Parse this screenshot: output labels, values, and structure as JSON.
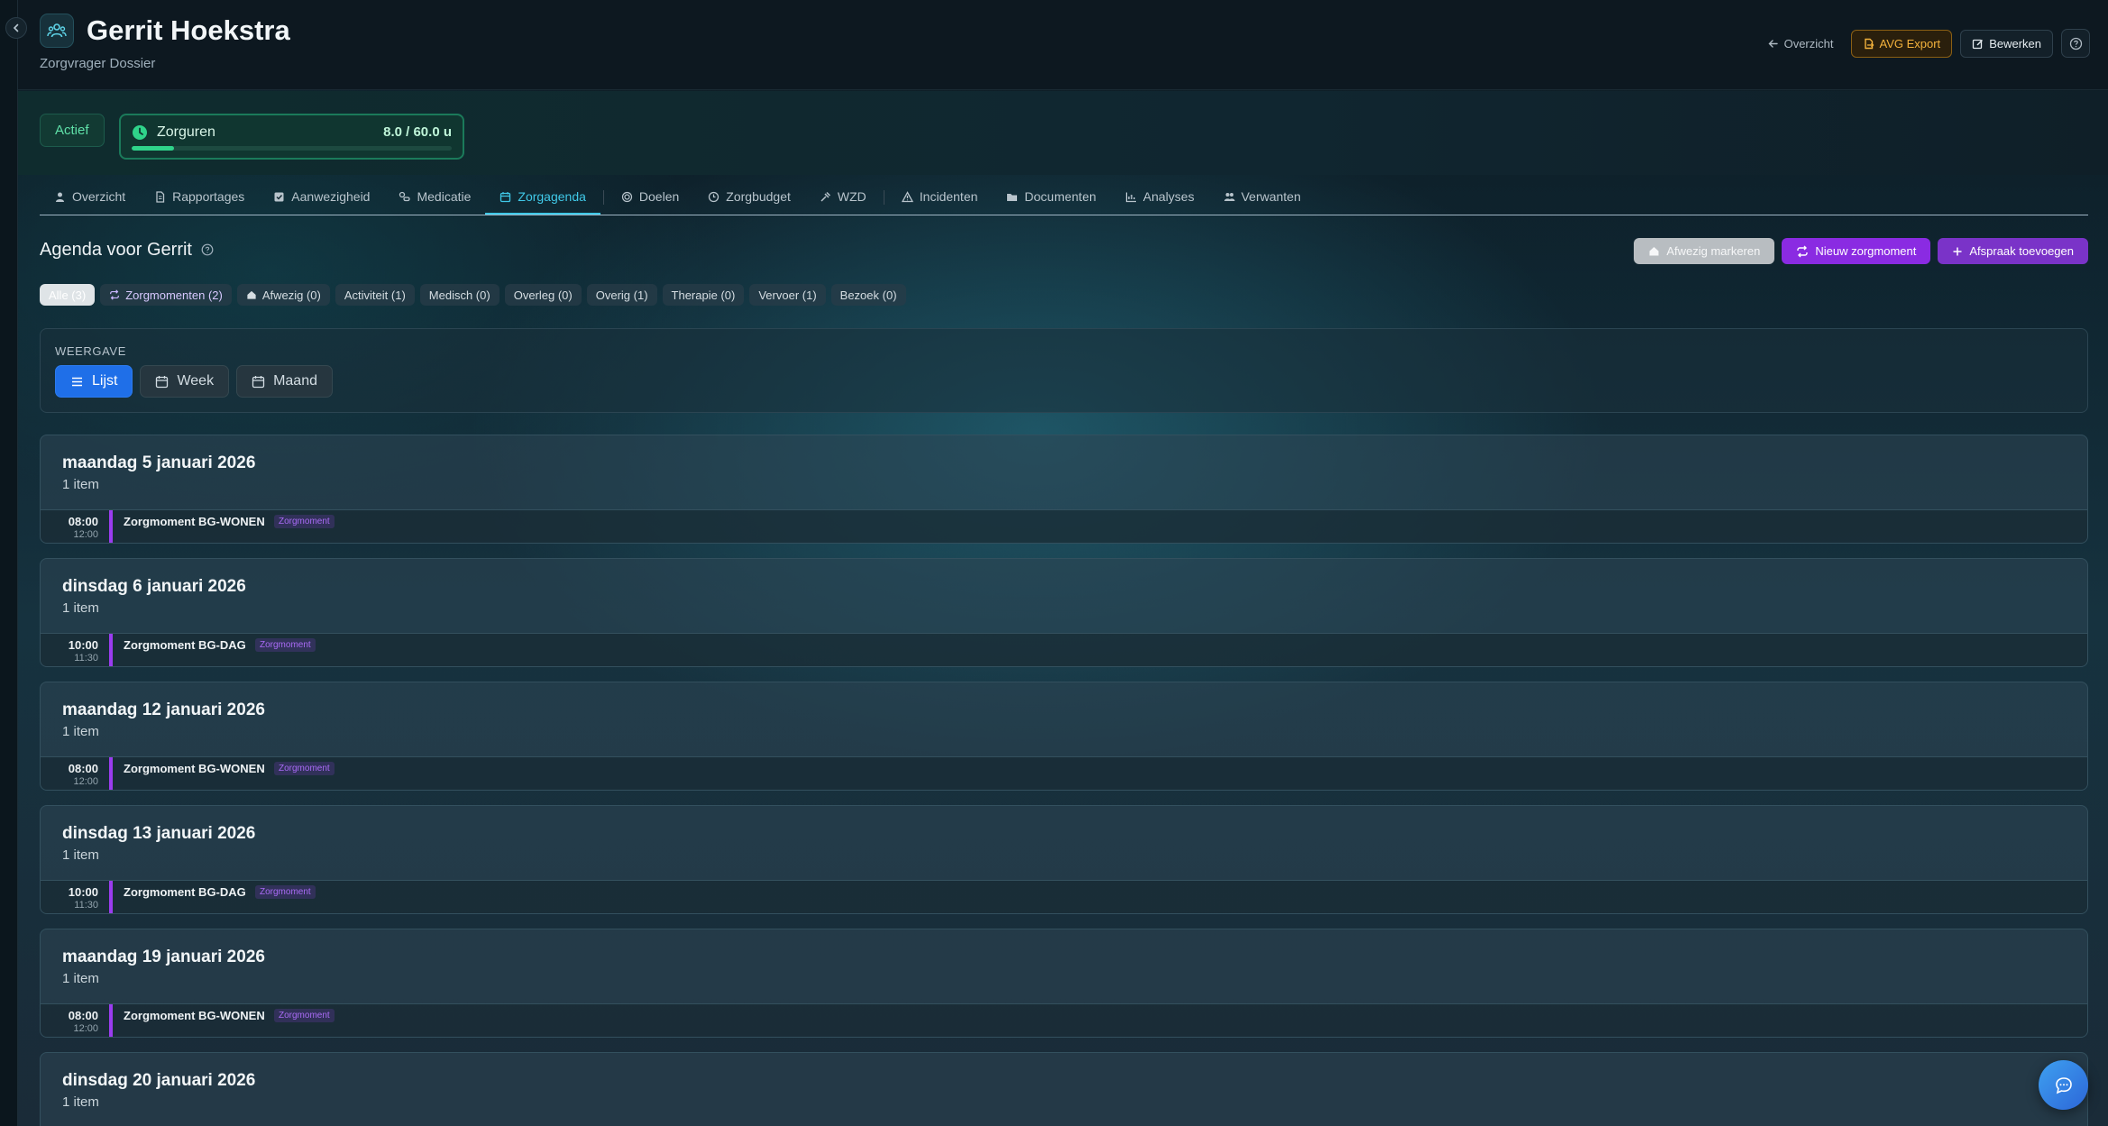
{
  "header": {
    "title": "Gerrit Hoekstra",
    "subtitle": "Zorgvrager Dossier",
    "back_label": "Overzicht",
    "avg_label": "AVG Export",
    "edit_label": "Bewerken"
  },
  "status": {
    "badge": "Actief",
    "hours_label": "Zorguren",
    "hours_value": "8.0 / 60.0 u",
    "hours_fraction": 0.133
  },
  "tabs": [
    {
      "label": "Overzicht",
      "icon": "person-icon"
    },
    {
      "label": "Rapportages",
      "icon": "document-icon"
    },
    {
      "label": "Aanwezigheid",
      "icon": "checkbox-icon"
    },
    {
      "label": "Medicatie",
      "icon": "pills-icon"
    },
    {
      "label": "Zorgagenda",
      "icon": "calendar-icon",
      "active": true
    },
    {
      "label": "Doelen",
      "icon": "target-icon"
    },
    {
      "label": "Zorgbudget",
      "icon": "coin-icon"
    },
    {
      "label": "WZD",
      "icon": "gavel-icon"
    },
    {
      "label": "Incidenten",
      "icon": "warning-icon"
    },
    {
      "label": "Documenten",
      "icon": "folder-icon"
    },
    {
      "label": "Analyses",
      "icon": "chart-icon"
    },
    {
      "label": "Verwanten",
      "icon": "people-icon"
    }
  ],
  "agenda": {
    "title": "Agenda voor Gerrit",
    "btn_absent": "Afwezig markeren",
    "btn_new_zorgmoment": "Nieuw zorgmoment",
    "btn_add_appointment": "Afspraak toevoegen"
  },
  "filters": [
    "Alle (3)",
    "Zorgmomenten (2)",
    "Afwezig (0)",
    "Activiteit (1)",
    "Medisch (0)",
    "Overleg (0)",
    "Overig (1)",
    "Therapie (0)",
    "Vervoer (1)",
    "Bezoek (0)"
  ],
  "view": {
    "label": "WEERGAVE",
    "options": [
      "Lijst",
      "Week",
      "Maand"
    ],
    "selected": "Lijst"
  },
  "days": [
    {
      "date": "maandag 5 januari 2026",
      "count": "1 item",
      "items": [
        {
          "start": "08:00",
          "end": "12:00",
          "name": "Zorgmoment BG-WONEN",
          "badge": "Zorgmoment"
        }
      ]
    },
    {
      "date": "dinsdag 6 januari 2026",
      "count": "1 item",
      "items": [
        {
          "start": "10:00",
          "end": "11:30",
          "name": "Zorgmoment BG-DAG",
          "badge": "Zorgmoment"
        }
      ]
    },
    {
      "date": "maandag 12 januari 2026",
      "count": "1 item",
      "items": [
        {
          "start": "08:00",
          "end": "12:00",
          "name": "Zorgmoment BG-WONEN",
          "badge": "Zorgmoment"
        }
      ]
    },
    {
      "date": "dinsdag 13 januari 2026",
      "count": "1 item",
      "items": [
        {
          "start": "10:00",
          "end": "11:30",
          "name": "Zorgmoment BG-DAG",
          "badge": "Zorgmoment"
        }
      ]
    },
    {
      "date": "maandag 19 januari 2026",
      "count": "1 item",
      "items": [
        {
          "start": "08:00",
          "end": "12:00",
          "name": "Zorgmoment BG-WONEN",
          "badge": "Zorgmoment"
        }
      ]
    },
    {
      "date": "dinsdag 20 januari 2026",
      "count": "1 item",
      "items": []
    }
  ],
  "colors": {
    "accent_tab": "#40c9e8",
    "zorgmoment_purple": "#9b3cf0",
    "status_green": "#2fd38a",
    "avg_orange": "#f3b23c",
    "primary_blue": "#1f6fe8"
  }
}
